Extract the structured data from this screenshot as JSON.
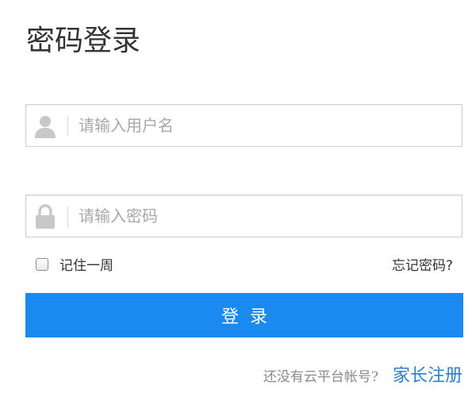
{
  "title": "密码登录",
  "username": {
    "icon": "user-icon",
    "value": "",
    "placeholder": "请输入用户名"
  },
  "password": {
    "icon": "lock-icon",
    "value": "",
    "placeholder": "请输入密码"
  },
  "remember": {
    "label": "记住一周",
    "checked": false
  },
  "forgot_label": "忘记密码?",
  "login_label": "登录",
  "footer": {
    "prompt": "还没有云平台帐号?",
    "register_label": "家长注册"
  },
  "colors": {
    "accent": "#1a8af0",
    "link": "#2f7fcf"
  }
}
